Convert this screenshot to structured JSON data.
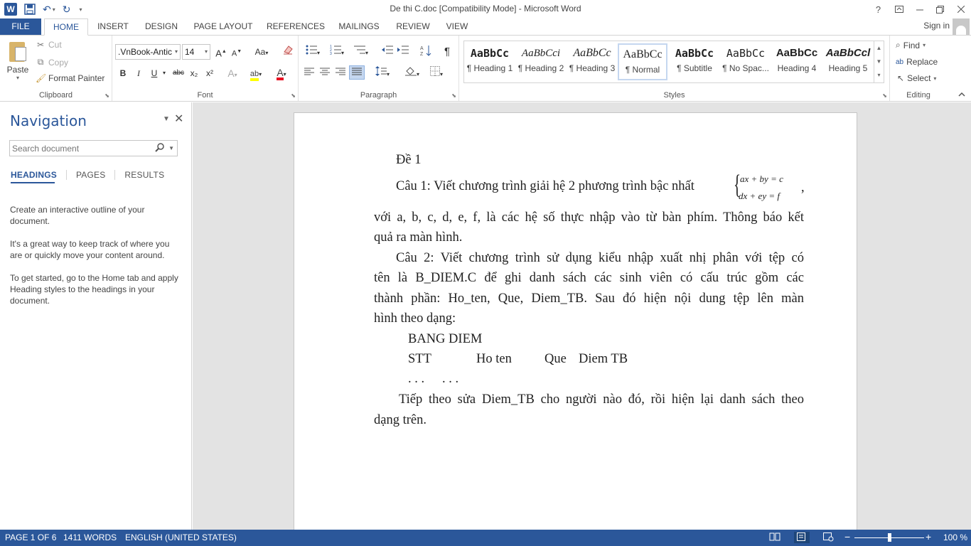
{
  "window": {
    "title": "De thi C.doc [Compatibility Mode] - Microsoft Word",
    "help": "?",
    "controls": [
      "help",
      "ribbon-display",
      "minimize",
      "restore",
      "close"
    ]
  },
  "qat": {
    "app_icon": "W",
    "save_icon": "save-icon",
    "undo_icon": "undo-icon",
    "redo_icon": "redo-icon"
  },
  "tabs": [
    {
      "label": "FILE"
    },
    {
      "label": "HOME"
    },
    {
      "label": "INSERT"
    },
    {
      "label": "DESIGN"
    },
    {
      "label": "PAGE LAYOUT"
    },
    {
      "label": "REFERENCES"
    },
    {
      "label": "MAILINGS"
    },
    {
      "label": "REVIEW"
    },
    {
      "label": "VIEW"
    }
  ],
  "account": {
    "signin": "Sign in"
  },
  "clipboard": {
    "paste": "Paste",
    "cut": "Cut",
    "copy": "Copy",
    "format_painter": "Format Painter",
    "group_label": "Clipboard"
  },
  "font": {
    "name": ".VnBook-Antic",
    "size": "14",
    "group_label": "Font",
    "bold": "B",
    "italic": "I",
    "underline": "U",
    "strike": "abc",
    "subscript": "x₂",
    "superscript": "x²",
    "grow": "A",
    "shrink": "A",
    "case": "Aa",
    "effects": "A",
    "highlight": "ab",
    "color": "A"
  },
  "paragraph": {
    "group_label": "Paragraph",
    "pilcrow": "¶"
  },
  "styles": {
    "group_label": "Styles",
    "items": [
      {
        "preview": "AaBbCc",
        "name": "¶ Heading 1"
      },
      {
        "preview": "AaBbCci",
        "name": "¶ Heading 2"
      },
      {
        "preview": "AaBbCc",
        "name": "¶ Heading 3"
      },
      {
        "preview": "AaBbCc",
        "name": "¶ Normal"
      },
      {
        "preview": "AaBbCc",
        "name": "¶ Subtitle"
      },
      {
        "preview": "AaBbCc",
        "name": "¶ No Spac..."
      },
      {
        "preview": "AaBbCc",
        "name": "Heading 4"
      },
      {
        "preview": "AaBbCcl",
        "name": "Heading 5"
      }
    ],
    "selected_index": 3
  },
  "editing": {
    "group_label": "Editing",
    "find": "Find",
    "replace": "Replace",
    "select": "Select"
  },
  "navigation": {
    "title": "Navigation",
    "search_placeholder": "Search document",
    "tabs": [
      "HEADINGS",
      "PAGES",
      "RESULTS"
    ],
    "active_tab": "HEADINGS",
    "paragraphs": [
      "Create an interactive outline of your document.",
      "It's a great way to keep track of where you are or quickly move your content around.",
      "To get started, go to the Home tab and apply Heading styles to the headings in your document."
    ]
  },
  "document": {
    "heading": "Đề 1",
    "q1_start": "Câu 1: Viết chương trình giải hệ 2 phương trình bậc nhất",
    "eq_line1": "ax + by = c",
    "eq_line2": "dx + ey = f",
    "q1_comma": ",",
    "q1_line2": "với a, b, c, d, e, f, là các hệ số thực nhập vào từ bàn phím. Thông báo kết",
    "q1_line3": "quả ra màn hình.",
    "q2_line1": "Câu 2: Viết chương trình sử dụng kiểu nhập xuất nhị phân với tệp có",
    "q2_line2": "tên là B_DIEM.C để ghi danh sách các sinh viên có cấu trúc gồm các",
    "q2_line3": "thành phần: Ho_ten, Que, Diem_TB. Sau đó hiện nội dung tệp lên màn",
    "q2_line4": "hình theo dạng:",
    "table_title": "BANG DIEM",
    "col_stt": "STT",
    "col_hoten": "Ho ten",
    "col_que": "Que",
    "col_diem": "Diem TB",
    "dots1": ". . .",
    "dots2": ". . .",
    "q2_line5": "Tiếp theo sửa Diem_TB cho người nào đó, rồi hiện lại danh sách theo",
    "q2_line6": "dạng trên."
  },
  "status": {
    "page": "PAGE 1 OF 6",
    "words": "1411 WORDS",
    "language": "ENGLISH (UNITED STATES)",
    "zoom": "100 %",
    "zoom_fraction": 0.5
  }
}
